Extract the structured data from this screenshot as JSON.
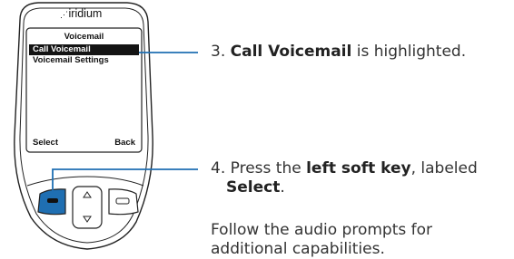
{
  "phone": {
    "brand": "iridium",
    "screen": {
      "title": "Voicemail",
      "menu_items": [
        {
          "label": "Call Voicemail",
          "selected": true
        },
        {
          "label": "Voicemail Settings",
          "selected": false
        }
      ],
      "left_soft_key": "Select",
      "right_soft_key": "Back"
    }
  },
  "callouts": [
    {
      "step": "3.",
      "bold": "Call Voicemail",
      "text": " is highlighted."
    },
    {
      "step": "4.",
      "text": "Press the ",
      "bold": "left soft key",
      "text2": ", labeled",
      "bold2": "Select",
      "end": "."
    },
    {
      "text": "Follow the audio prompts for",
      "text2": "additional capabilities."
    }
  ],
  "colors": {
    "highlight_key": "#1f6fb2",
    "callout_line": "#1f6fb2",
    "selected_row": "#141414"
  }
}
